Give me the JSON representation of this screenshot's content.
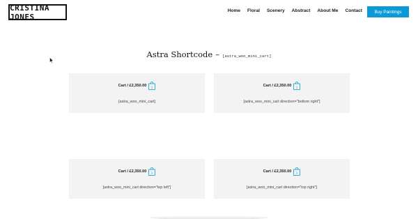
{
  "header": {
    "logo_text": "Cristina Jones",
    "nav": [
      "Home",
      "Floral",
      "Scenery",
      "Abstract",
      "About Me",
      "Contact"
    ],
    "cta_label": "Buy Paintings"
  },
  "main": {
    "title": "Astra Shortcode",
    "dash": "–",
    "title_code": "[astra_woo_mini_cart]",
    "cards": [
      {
        "cart_label": "Cart / £2,350.00",
        "count": "1",
        "shortcode": "[astra_woo_mini_cart]"
      },
      {
        "cart_label": "Cart / £2,350.00",
        "count": "1",
        "shortcode": "[astra_woo_mini_cart direction=\"bottom right\"]"
      },
      {
        "cart_label": "Cart / £2,350.00",
        "count": "1",
        "shortcode": "[astra_woo_mini_cart direction=\"top left\"]"
      },
      {
        "cart_label": "Cart / £2,350.00",
        "count": "1",
        "shortcode": "[astra_woo_mini_cart direction=\"top right\"]"
      }
    ]
  },
  "colors": {
    "accent": "#0a9ad8",
    "card_bg": "#f3f3f3"
  },
  "icons": [
    "shopping-bag-icon",
    "mouse-cursor-icon"
  ]
}
